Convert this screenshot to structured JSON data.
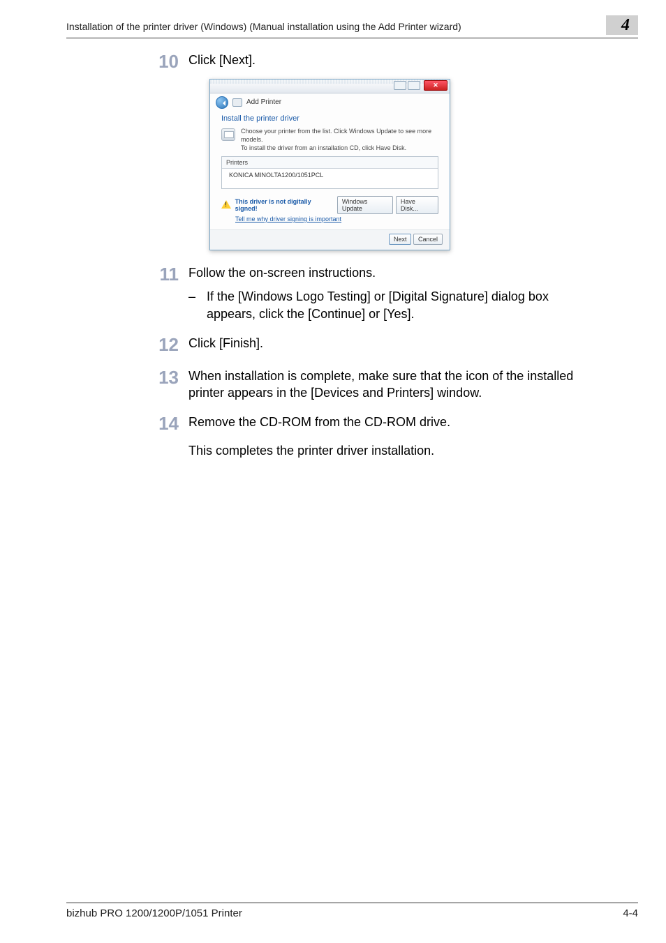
{
  "header": {
    "title": "Installation of the printer driver (Windows) (Manual installation using the Add Printer wizard)",
    "chapter_number": "4"
  },
  "steps": {
    "s10": {
      "num": "10",
      "text": "Click [Next]."
    },
    "s11": {
      "num": "11",
      "text": "Follow the on-screen instructions.",
      "bullet": "If the [Windows Logo Testing] or [Digital Signature] dialog box appears, click the [Continue] or [Yes]."
    },
    "s12": {
      "num": "12",
      "text": "Click [Finish]."
    },
    "s13": {
      "num": "13",
      "text": "When installation is complete, make sure that the icon of the installed printer appears in the [Devices and Printers] window."
    },
    "s14": {
      "num": "14",
      "text": "Remove the CD-ROM from the CD-ROM drive.",
      "follow": "This completes the printer driver installation."
    }
  },
  "dialog": {
    "nav_title": "Add Printer",
    "heading": "Install the printer driver",
    "line1": "Choose your printer from the list. Click Windows Update to see more models.",
    "line2": "To install the driver from an installation CD, click Have Disk.",
    "printers_label": "Printers",
    "printer_item": "KONICA MINOLTA1200/1051PCL",
    "warn_text": "This driver is not digitally signed!",
    "link_text": "Tell me why driver signing is important",
    "btn_windows_update": "Windows Update",
    "btn_have_disk": "Have Disk...",
    "btn_next": "Next",
    "btn_cancel": "Cancel",
    "btn_close_symbol": "✕"
  },
  "footer": {
    "left": "bizhub PRO 1200/1200P/1051 Printer",
    "right": "4-4"
  }
}
